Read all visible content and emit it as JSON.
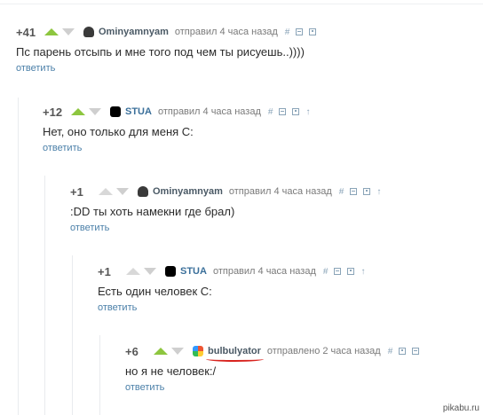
{
  "comments": [
    {
      "rating": "+41",
      "user": "Ominyamnyam",
      "time": "отправил 4 часа назад",
      "text": "Пс парень отсыпь и мне того под чем ты рисуешь..))))",
      "reply": "ответить",
      "link": "#"
    },
    {
      "rating": "+12",
      "user": "STUA",
      "time": "отправил 4 часа назад",
      "text": "Нет, оно только для меня С:",
      "reply": "ответить",
      "link": "#",
      "up_arrow": "↑"
    },
    {
      "rating": "+1",
      "user": "Ominyamnyam",
      "time": "отправил 4 часа назад",
      "text": ":DD ты хоть намекни где брал)",
      "reply": "ответить",
      "link": "#",
      "up_arrow": "↑"
    },
    {
      "rating": "+1",
      "user": "STUA",
      "time": "отправил 4 часа назад",
      "text": "Есть один человек С:",
      "reply": "ответить",
      "link": "#",
      "up_arrow": "↑"
    },
    {
      "rating": "+6",
      "user": "bulbulyator",
      "time": "отправлено 2 часа назад",
      "text": "но я не человек:/",
      "reply": "ответить",
      "link": "#"
    }
  ],
  "watermark": "pikabu.ru",
  "colors": {
    "upvote": "#8dc63f",
    "link": "#4a7fa8",
    "highlight": "#d8231e"
  }
}
